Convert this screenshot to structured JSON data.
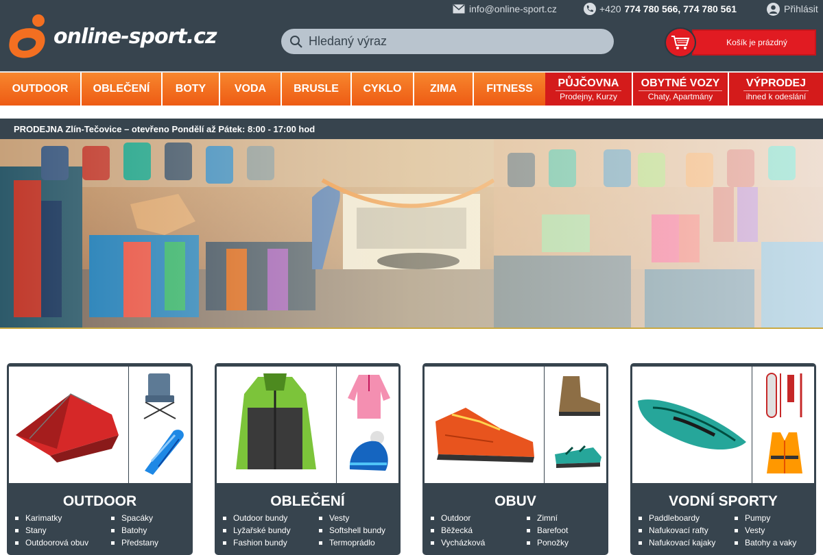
{
  "header": {
    "logo_text": "online-sport.cz",
    "email": "info@online-sport.cz",
    "phone_prefix": "+420",
    "phone_numbers": "774 780 566, 774 780 561",
    "login": "Přihlásit",
    "search_placeholder": "Hledaný výraz",
    "cart_label": "Košík je prázdný",
    "colors": {
      "header_bg": "#37444e",
      "accent_orange": "#f36f21",
      "accent_red": "#d41b1b"
    }
  },
  "nav": {
    "items": [
      "OUTDOOR",
      "OBLEČENÍ",
      "BOTY",
      "VODA",
      "BRUSLE",
      "CYKLO",
      "ZIMA",
      "FITNESS"
    ],
    "special": [
      {
        "title": "PŮJČOVNA",
        "subtitle": "Prodejny, Kurzy"
      },
      {
        "title": "OBYTNÉ VOZY",
        "subtitle": "Chaty, Apartmány"
      },
      {
        "title": "VÝPRODEJ",
        "subtitle": "ihned k odeslání"
      }
    ]
  },
  "store_banner": "PRODEJNA Zlín-Tečovice – otevřeno Pondělí až Pátek: 8:00 - 17:00 hod",
  "categories": [
    {
      "title": "OUTDOOR",
      "col1": [
        "Karimatky",
        "Stany",
        "Outdoorová obuv"
      ],
      "col2": [
        "Spacáky",
        "Batohy",
        "Předstany"
      ],
      "images": [
        "tent",
        "camping-chair",
        "sleeping-bag"
      ]
    },
    {
      "title": "OBLEČENÍ",
      "col1": [
        "Outdoor bundy",
        "Lyžařské bundy",
        "Fashion bundy"
      ],
      "col2": [
        "Vesty",
        "Softshell bundy",
        "Termoprádlo"
      ],
      "images": [
        "jacket",
        "fleece-sweater",
        "beanie"
      ]
    },
    {
      "title": "OBUV",
      "col1": [
        "Outdoor",
        "Běžecká",
        "Vycházková"
      ],
      "col2": [
        "Zimní",
        "Barefoot",
        "Ponožky"
      ],
      "images": [
        "approach-shoe",
        "hiking-boot",
        "sandal"
      ]
    },
    {
      "title": "VODNÍ SPORTY",
      "col1": [
        "Paddleboardy",
        "Nafukovací rafty",
        "Nafukovací kajaky"
      ],
      "col2": [
        "Pumpy",
        "Vesty",
        "Batohy a vaky"
      ],
      "images": [
        "inflatable-kayak",
        "paddleboard-set",
        "life-vest"
      ]
    }
  ]
}
